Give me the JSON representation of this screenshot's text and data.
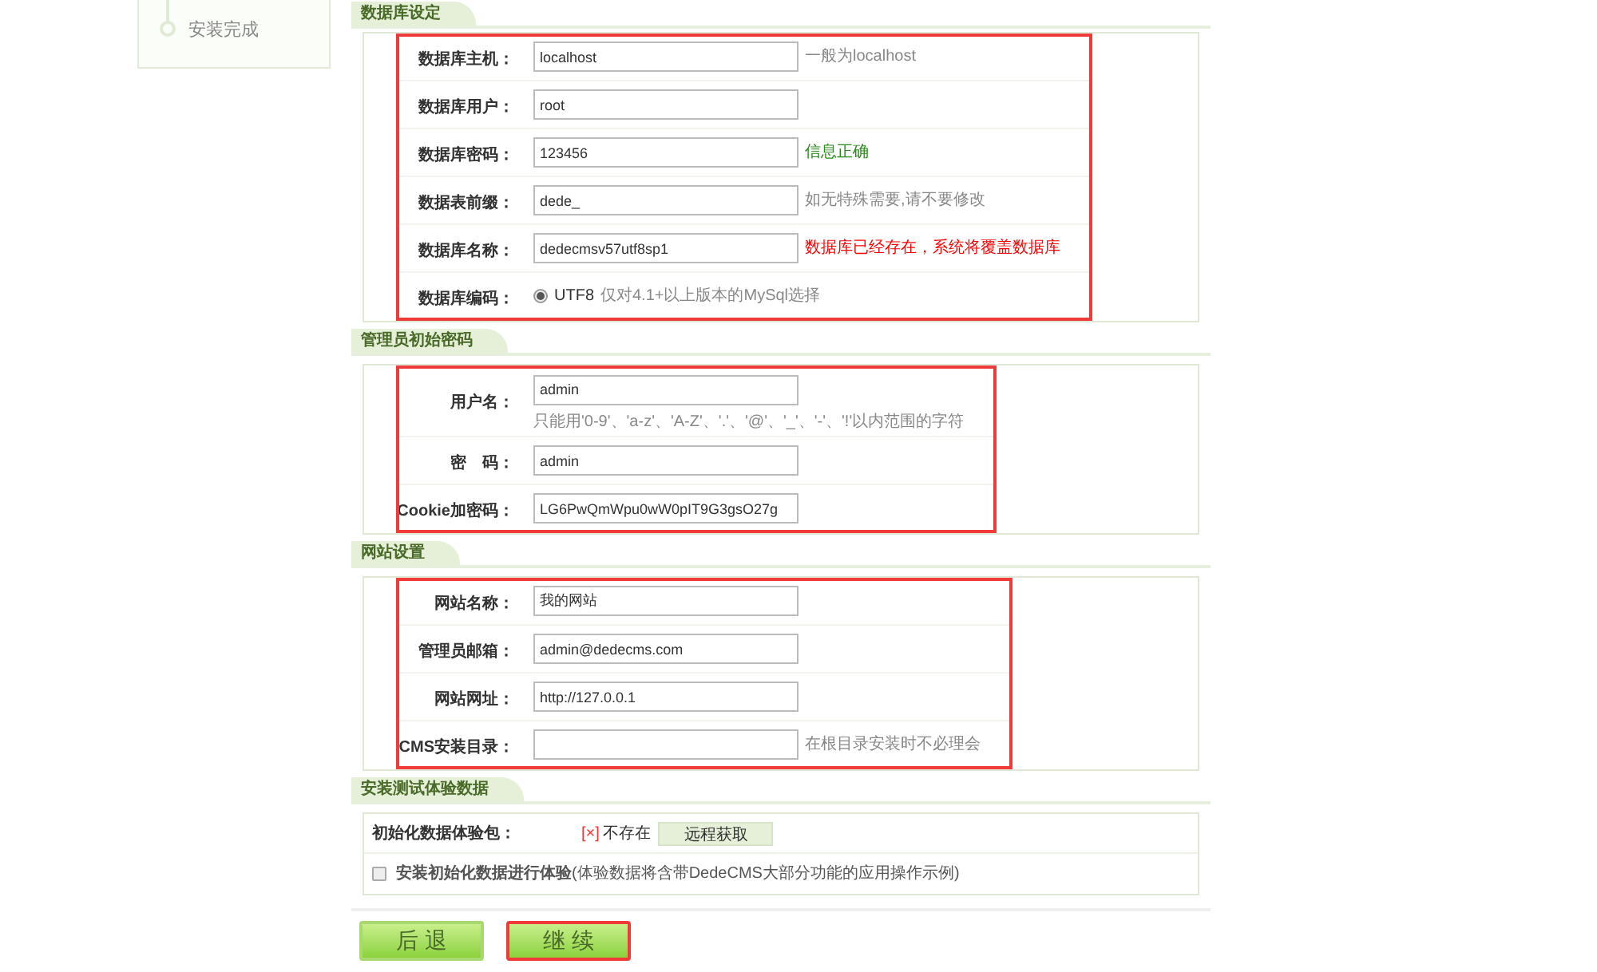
{
  "sidebar": {
    "steps": [
      {
        "label": "安装完成"
      }
    ]
  },
  "sections": [
    {
      "title": "数据库设定",
      "highlighted": true,
      "rows": [
        {
          "kind": "field",
          "label": "数据库主机：",
          "value": "localhost",
          "hint": "一般为localhost",
          "color": "#888888"
        },
        {
          "kind": "field",
          "label": "数据库用户：",
          "value": "root"
        },
        {
          "kind": "field",
          "label": "数据库密码：",
          "value": "123456",
          "hint": "信息正确",
          "color": "#2a8a1a"
        },
        {
          "kind": "field",
          "label": "数据表前缀：",
          "value": "dede_",
          "hint": "如无特殊需要,请不要修改",
          "color": "#888888"
        },
        {
          "kind": "field",
          "label": "数据库名称：",
          "value": "dedecmsv57utf8sp1",
          "hint": "数据库已经存在，系统将覆盖数据库",
          "color": "#ff0000"
        },
        {
          "kind": "radio",
          "label": "数据库编码：",
          "option": "UTF8",
          "selected": true,
          "hint": "仅对4.1+以上版本的MySql选择",
          "color": "#888888"
        }
      ]
    },
    {
      "title": "管理员初始密码",
      "highlighted": true,
      "rows": [
        {
          "kind": "field",
          "label": "用户名：",
          "value": "admin",
          "hint": "只能用'0-9'、'a-z'、'A-Z'、'.'、'@'、'_'、'-'、'!'以内范围的字符",
          "color": "#888888",
          "hint_below": true
        },
        {
          "kind": "field",
          "label": "密　码：",
          "value": "admin"
        },
        {
          "kind": "field",
          "label": "Cookie加密码：",
          "value": "LG6PwQmWpu0wW0pIT9G3gsO27g"
        }
      ]
    },
    {
      "title": "网站设置",
      "highlighted": true,
      "rows": [
        {
          "kind": "field",
          "label": "网站名称：",
          "value": "我的网站"
        },
        {
          "kind": "field",
          "label": "管理员邮箱：",
          "value": "admin@dedecms.com"
        },
        {
          "kind": "field",
          "label": "网站网址：",
          "value": "http://127.0.0.1"
        },
        {
          "kind": "field",
          "label": "CMS安装目录：",
          "value": "",
          "hint": "在根目录安装时不必理会",
          "color": "#888888"
        }
      ]
    },
    {
      "title": "安装测试体验数据",
      "rows": [
        {
          "kind": "package",
          "label": "初始化数据体验包：",
          "mark": "[×]",
          "status": "不存在",
          "button": "远程获取"
        },
        {
          "kind": "checkbox",
          "checked": false,
          "text": "**安装初始化数据进行体验**(体验数据将含带DedeCMS大部分功能的应用操作示例)"
        }
      ]
    }
  ],
  "buttons": [
    {
      "label": "后 退",
      "highlighted": false
    },
    {
      "label": "继 续",
      "highlighted": true
    }
  ]
}
